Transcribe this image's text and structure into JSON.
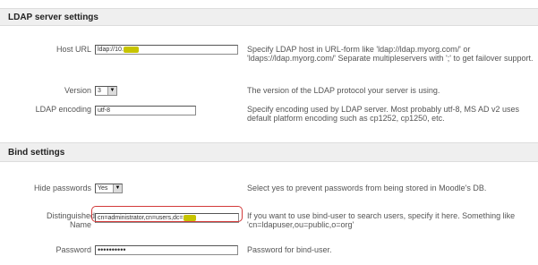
{
  "ldap_section": {
    "title": "LDAP server settings",
    "host_url": {
      "label": "Host URL",
      "value": "ldap://10.",
      "redacted": "xxxxx",
      "description": "Specify LDAP host in URL-form like 'ldap://ldap.myorg.com/' or 'ldaps://ldap.myorg.com/' Separate multipleservers with ';' to get failover support."
    },
    "version": {
      "label": "Version",
      "value": "3",
      "description": "The version of the LDAP protocol your server is using."
    },
    "encoding": {
      "label": "LDAP encoding",
      "value": "utf-8",
      "description": "Specify encoding used by LDAP server. Most probably utf-8, MS AD v2 uses default platform encoding such as cp1252, cp1250, etc."
    }
  },
  "bind_section": {
    "title": "Bind settings",
    "hide_passwords": {
      "label": "Hide passwords",
      "value": "Yes",
      "description": "Select yes to prevent passwords from being stored in Moodle's DB."
    },
    "distinguished_name": {
      "label": "Distinguished Name",
      "value": "cn=administrator,cn=users,dc=",
      "redacted": "xxxx",
      "description": "If you want to use bind-user to search users, specify it here. Something like 'cn=ldapuser,ou=public,o=org'"
    },
    "password": {
      "label": "Password",
      "value": "••••••••••",
      "description": "Password for bind-user."
    }
  },
  "colors": {
    "highlight": "#c7c400",
    "focus_ring": "#d23a3a",
    "section_bg": "#efefef"
  }
}
